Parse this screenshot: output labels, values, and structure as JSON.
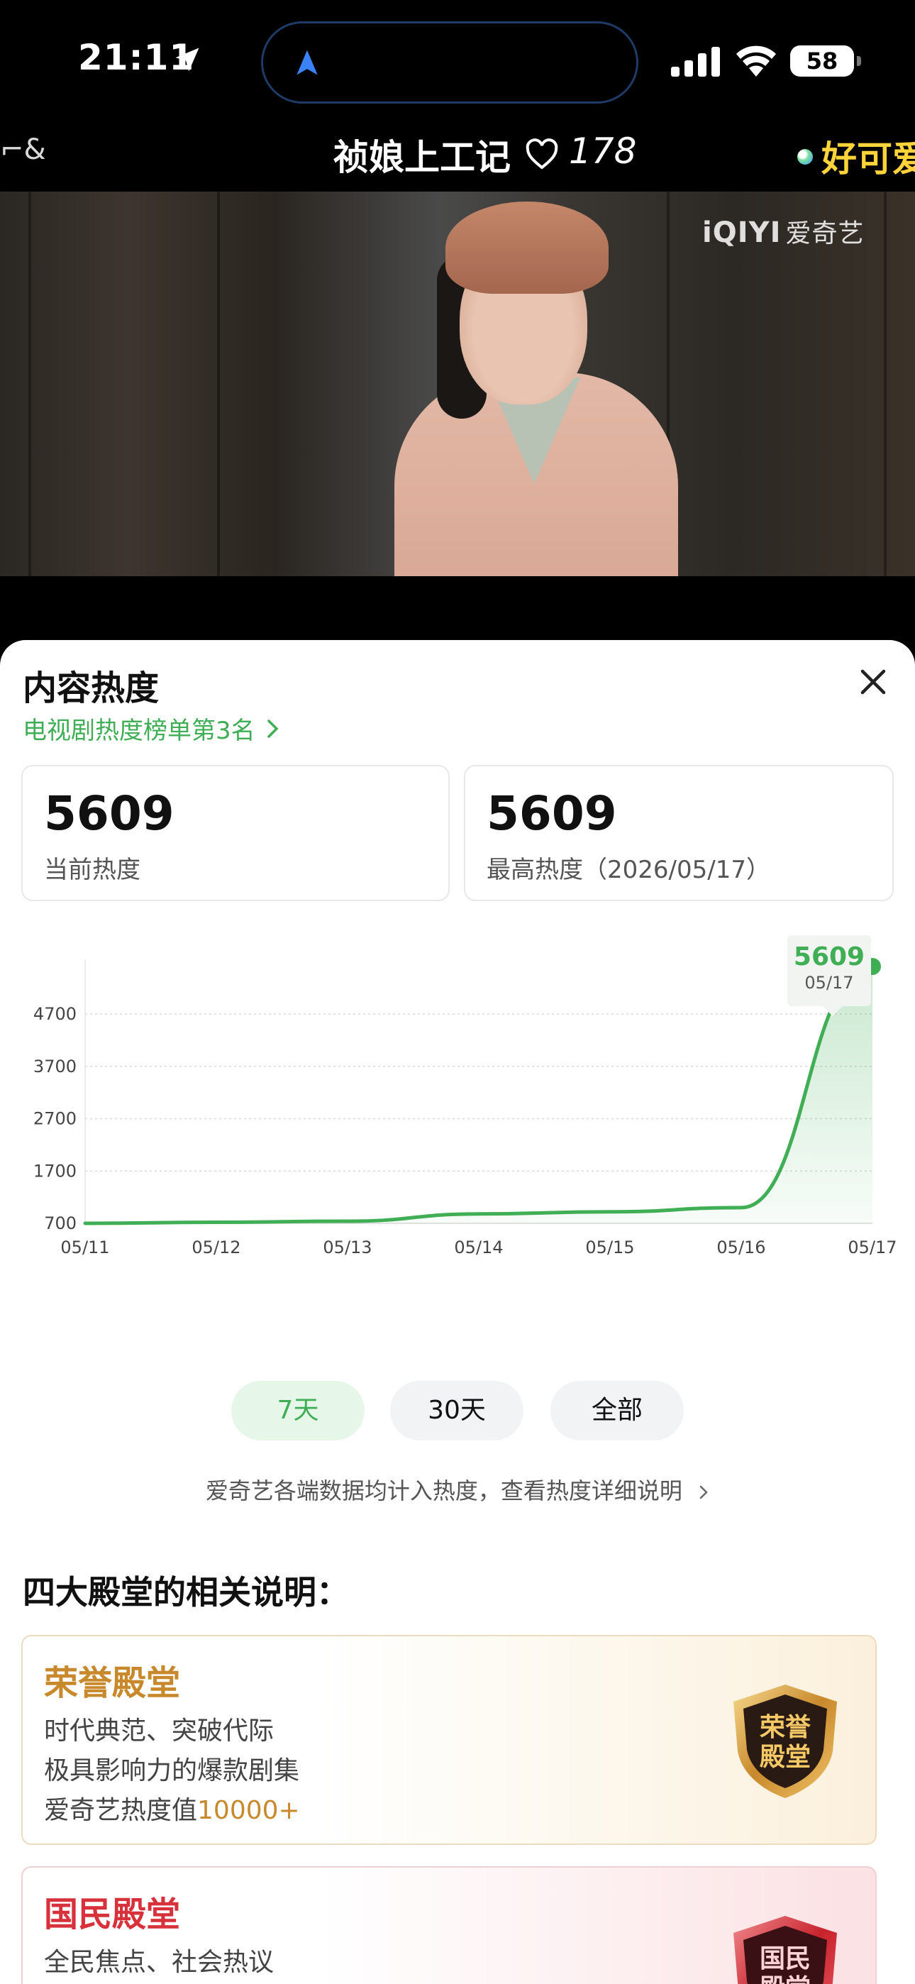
{
  "status_bar": {
    "time": "21:11",
    "battery": "58"
  },
  "video": {
    "scroll_fragment": "⌐&",
    "title": "祯娘上工记",
    "like_count": "178",
    "danmaku": "好可爱",
    "watermark_logo": "iQIYI",
    "watermark_cn": "爱奇艺"
  },
  "panel": {
    "title": "内容热度",
    "rank_link": "电视剧热度榜单第3名",
    "current": {
      "value": "5609",
      "label": "当前热度"
    },
    "peak": {
      "value": "5609",
      "label": "最高热度（2026/05/17）"
    },
    "tooltip": {
      "value": "5609",
      "date": "05/17"
    },
    "range_tabs": [
      "7天",
      "30天",
      "全部"
    ],
    "active_tab": "7天",
    "note": "爱奇艺各端数据均计入热度，查看热度详细说明",
    "accent_color": "#3fae55"
  },
  "chart_data": {
    "type": "area",
    "x": [
      "05/11",
      "05/12",
      "05/13",
      "05/14",
      "05/15",
      "05/16",
      "05/17"
    ],
    "series": [
      {
        "values": [
          700,
          720,
          740,
          880,
          920,
          1000,
          5609
        ]
      }
    ],
    "yticks": [
      700,
      1700,
      2700,
      3700,
      4700
    ],
    "ylim": [
      700,
      5609
    ],
    "grid": true,
    "line_color": "#3fae55"
  },
  "halls": {
    "heading": "四大殿堂的相关说明：",
    "honor": {
      "name": "荣誉殿堂",
      "line1": "时代典范、突破代际",
      "line2": "极具影响力的爆款剧集",
      "line3_prefix": "爱奇艺热度值",
      "line3_value": "10000+",
      "badge_text_1": "荣誉",
      "badge_text_2": "殿堂",
      "color": "#c8892c"
    },
    "national": {
      "name": "国民殿堂",
      "line1": "全民焦点、社会热议",
      "badge_text_1": "国民",
      "badge_text_2": "殿堂",
      "color": "#d7323c"
    }
  }
}
